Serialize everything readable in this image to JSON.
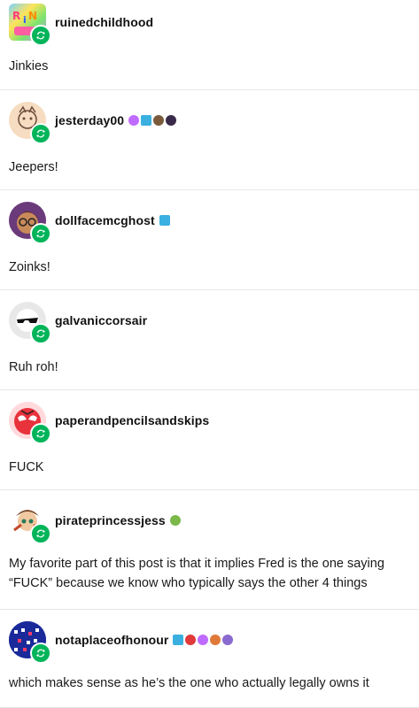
{
  "posts": [
    {
      "username": "ruinedchildhood",
      "text": "Jinkies"
    },
    {
      "username": "jesterday00",
      "text": "Jeepers!"
    },
    {
      "username": "dollfacemcghost",
      "text": "Zoinks!"
    },
    {
      "username": "galvaniccorsair",
      "text": "Ruh roh!"
    },
    {
      "username": "paperandpencilsandskips",
      "text": "FUCK"
    },
    {
      "username": "pirateprincessjess",
      "text": "My favorite part of this post is that it implies Fred is the one saying “FUCK” because we know who typically says the other 4 things"
    },
    {
      "username": "notaplaceofhonour",
      "text": "which makes sense as he’s the one who actually legally owns it"
    }
  ],
  "colors": {
    "reblog": "#00b45a",
    "divider": "#e6e6e6"
  }
}
